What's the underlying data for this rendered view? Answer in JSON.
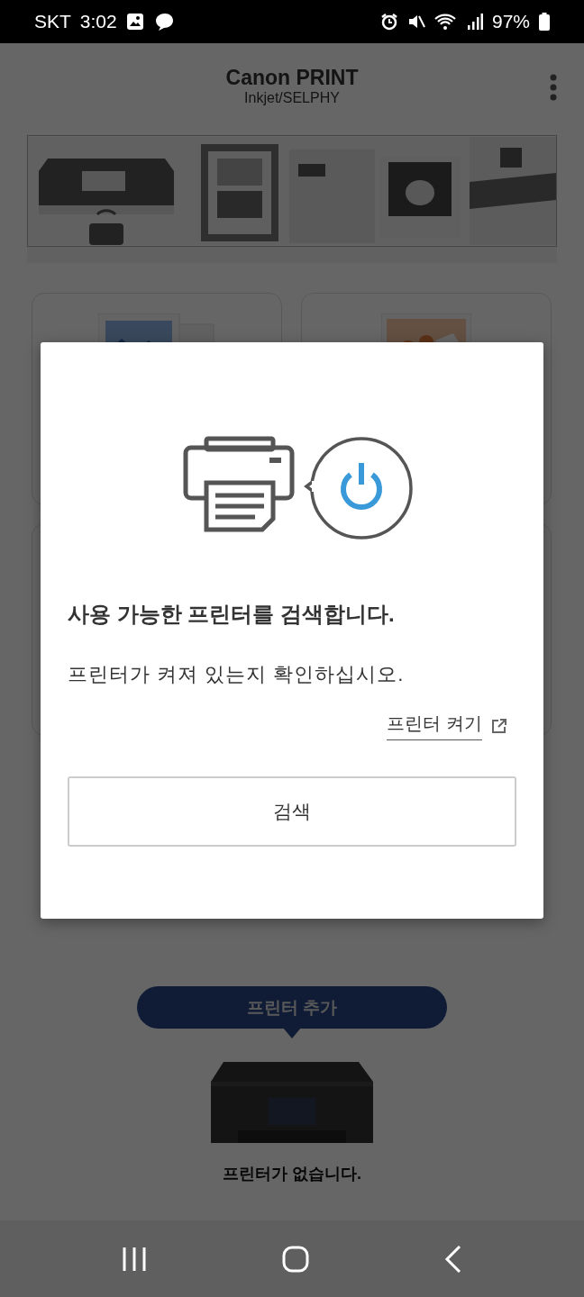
{
  "status_bar": {
    "carrier": "SKT",
    "time": "3:02",
    "battery": "97%"
  },
  "app_bar": {
    "title": "Canon PRINT",
    "subtitle": "Inkjet/SELPHY"
  },
  "add_printer": {
    "label": "프린터 추가"
  },
  "printer_status": "프린터가 없습니다.",
  "dialog": {
    "heading": "사용 가능한 프린터를 검색합니다.",
    "message": "프린터가 켜져 있는지 확인하십시오.",
    "link": "프린터 켜기",
    "button": "검색"
  }
}
